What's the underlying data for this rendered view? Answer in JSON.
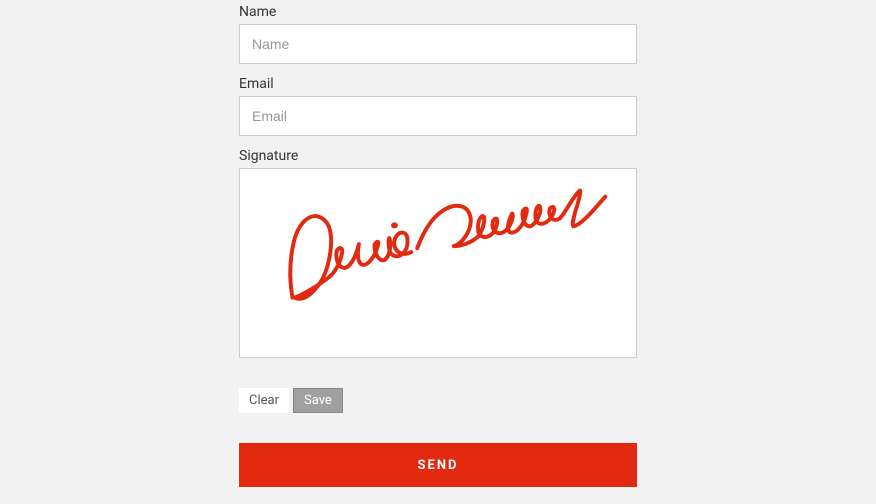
{
  "form": {
    "name": {
      "label": "Name",
      "placeholder": "Name",
      "value": ""
    },
    "email": {
      "label": "Email",
      "placeholder": "Email",
      "value": ""
    },
    "signature": {
      "label": "Signature",
      "content": "DroidCrunch",
      "stroke_color": "#e22a10"
    }
  },
  "buttons": {
    "clear": "Clear",
    "save": "Save",
    "send": "SEND"
  }
}
